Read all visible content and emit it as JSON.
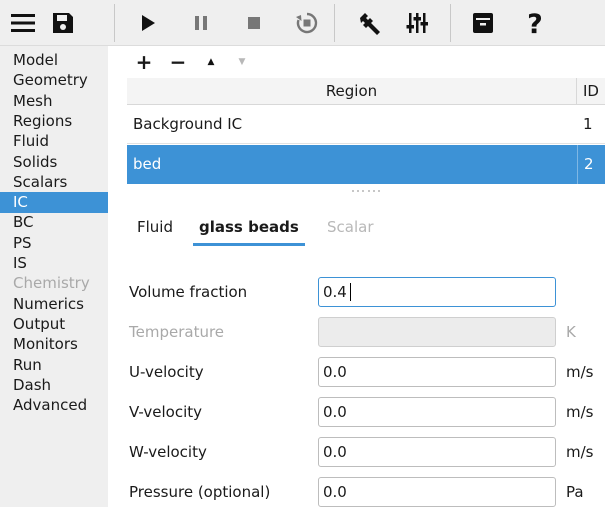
{
  "toolbar": {
    "buttons": [
      {
        "name": "menu",
        "icon": "hamburger-menu-icon"
      },
      {
        "name": "save",
        "icon": "save-icon"
      },
      {
        "name": "run",
        "icon": "play-icon"
      },
      {
        "name": "pause",
        "icon": "pause-icon"
      },
      {
        "name": "stop",
        "icon": "stop-icon"
      },
      {
        "name": "reset",
        "icon": "reset-icon"
      },
      {
        "name": "build",
        "icon": "wrench-icon"
      },
      {
        "name": "settings",
        "icon": "sliders-icon"
      },
      {
        "name": "export",
        "icon": "archive-icon"
      },
      {
        "name": "help",
        "icon": "help-icon"
      }
    ]
  },
  "sidebar": {
    "items": [
      {
        "label": "Model",
        "state": "normal"
      },
      {
        "label": "Geometry",
        "state": "normal"
      },
      {
        "label": "Mesh",
        "state": "normal"
      },
      {
        "label": "Regions",
        "state": "normal"
      },
      {
        "label": "Fluid",
        "state": "normal"
      },
      {
        "label": "Solids",
        "state": "normal"
      },
      {
        "label": "Scalars",
        "state": "normal"
      },
      {
        "label": "IC",
        "state": "active"
      },
      {
        "label": "BC",
        "state": "normal"
      },
      {
        "label": "PS",
        "state": "normal"
      },
      {
        "label": "IS",
        "state": "normal"
      },
      {
        "label": "Chemistry",
        "state": "disabled"
      },
      {
        "label": "Numerics",
        "state": "normal"
      },
      {
        "label": "Output",
        "state": "normal"
      },
      {
        "label": "Monitors",
        "state": "normal"
      },
      {
        "label": "Run",
        "state": "normal"
      },
      {
        "label": "Dash",
        "state": "normal"
      },
      {
        "label": "Advanced",
        "state": "normal"
      }
    ]
  },
  "region_toolbar": {
    "add": "+",
    "remove": "−",
    "up": "▲",
    "down": "▼"
  },
  "regions_table": {
    "columns": [
      "Region",
      "ID"
    ],
    "rows": [
      {
        "region": "Background IC",
        "id": "1",
        "selected": false
      },
      {
        "region": "bed",
        "id": "2",
        "selected": true
      }
    ]
  },
  "tabs": [
    {
      "label": "Fluid",
      "state": "normal"
    },
    {
      "label": "glass beads",
      "state": "active"
    },
    {
      "label": "Scalar",
      "state": "disabled"
    }
  ],
  "form": {
    "fields": [
      {
        "label": "Volume fraction",
        "value": "0.4",
        "unit": "",
        "state": "focused"
      },
      {
        "label": "Temperature",
        "value": "",
        "unit": "K",
        "state": "disabled"
      },
      {
        "label": "U-velocity",
        "value": "0.0",
        "unit": "m/s",
        "state": "normal"
      },
      {
        "label": "V-velocity",
        "value": "0.0",
        "unit": "m/s",
        "state": "normal"
      },
      {
        "label": "W-velocity",
        "value": "0.0",
        "unit": "m/s",
        "state": "normal"
      },
      {
        "label": "Pressure (optional)",
        "value": "0.0",
        "unit": "Pa",
        "state": "normal"
      }
    ]
  },
  "colors": {
    "accent": "#3d92d6",
    "sidebar_bg": "#efefef",
    "disabled_text": "#a9a9a9"
  }
}
